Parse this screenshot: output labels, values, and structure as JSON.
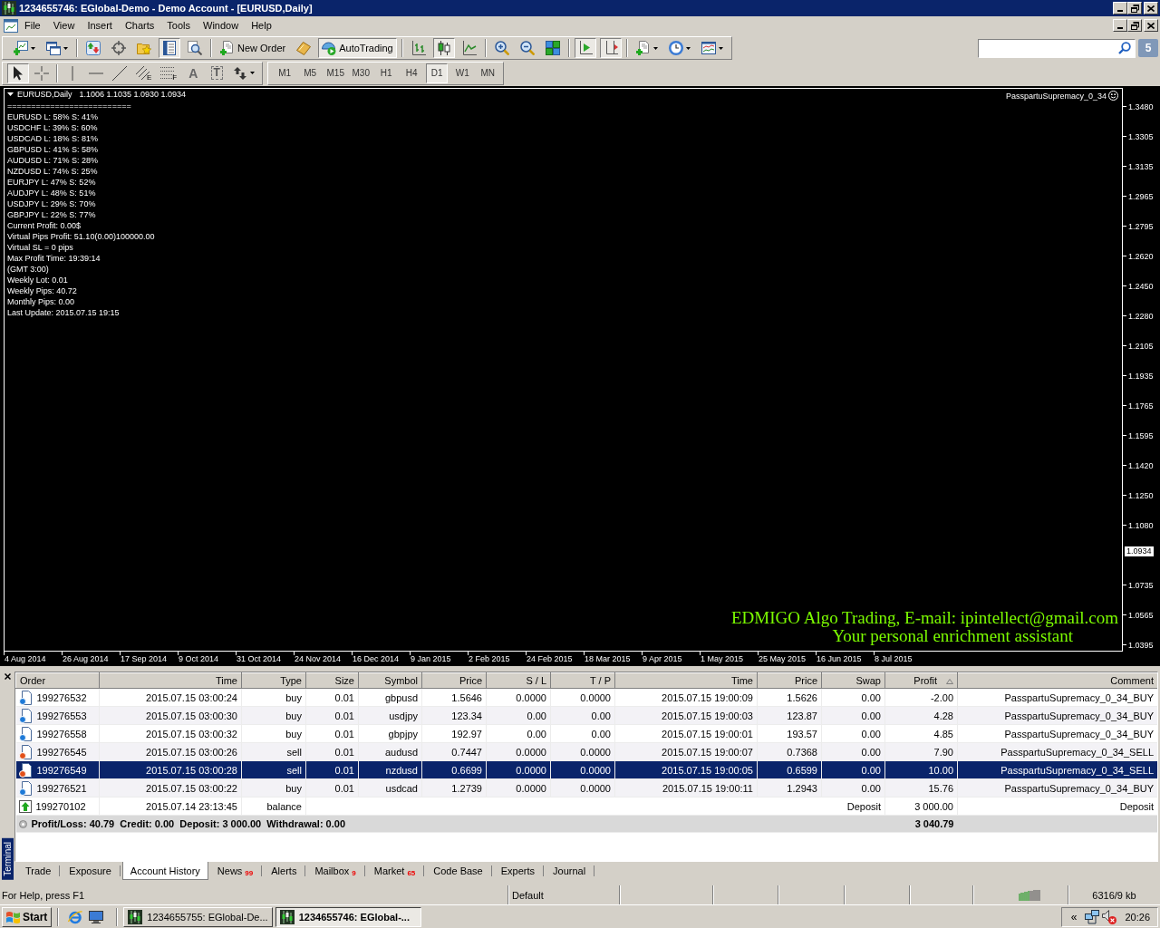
{
  "window": {
    "title": "1234655746: EGlobal-Demo - Demo Account - [EURUSD,Daily]"
  },
  "menu": [
    "File",
    "View",
    "Insert",
    "Charts",
    "Tools",
    "Window",
    "Help"
  ],
  "toolbar": {
    "groups": [
      [
        {
          "pressed": false,
          "dropdown": true
        },
        {
          "pressed": false,
          "dropdown": true
        }
      ],
      [
        {
          "pressed": false,
          "dropdown": false
        },
        {
          "pressed": false,
          "dropdown": false
        },
        {
          "pressed": false,
          "dropdown": false
        },
        {
          "pressed": true,
          "dropdown": false
        },
        {
          "pressed": false,
          "dropdown": false
        }
      ],
      [
        {
          "label": "New Order",
          "pressed": false,
          "dropdown": false
        },
        {
          "pressed": false,
          "dropdown": false
        },
        {
          "label": "AutoTrading",
          "pressed": true,
          "dropdown": false
        }
      ],
      [
        {
          "pressed": false,
          "dropdown": false
        },
        {
          "pressed": true,
          "dropdown": false
        },
        {
          "pressed": false,
          "dropdown": false
        }
      ],
      [
        {
          "pressed": false,
          "dropdown": false
        },
        {
          "pressed": false,
          "dropdown": false
        },
        {
          "pressed": false,
          "dropdown": false
        }
      ],
      [
        {
          "pressed": true,
          "dropdown": false
        },
        {
          "pressed": true,
          "dropdown": false
        }
      ],
      [
        {
          "pressed": false,
          "dropdown": true
        },
        {
          "pressed": false,
          "dropdown": true
        },
        {
          "pressed": false,
          "dropdown": true
        }
      ]
    ],
    "badge": "5"
  },
  "drawing_tools": {
    "groups": [
      [
        {
          "pressed": true,
          "dropdown": false
        },
        {
          "pressed": false,
          "dropdown": false
        }
      ],
      [
        {
          "pressed": false,
          "dropdown": false
        },
        {
          "pressed": false,
          "dropdown": false
        },
        {
          "pressed": false,
          "dropdown": false
        },
        {
          "label": "E",
          "pressed": false,
          "dropdown": false
        },
        {
          "label": "F",
          "pressed": false,
          "dropdown": false
        },
        {
          "label": "A",
          "pressed": false,
          "dropdown": false
        },
        {
          "label": "T",
          "pressed": false,
          "dropdown": false
        },
        {
          "pressed": false,
          "dropdown": true
        }
      ]
    ]
  },
  "timeframes": [
    {
      "label": "M1",
      "selected": false
    },
    {
      "label": "M5",
      "selected": false
    },
    {
      "label": "M15",
      "selected": false
    },
    {
      "label": "M30",
      "selected": false
    },
    {
      "label": "H1",
      "selected": false
    },
    {
      "label": "H4",
      "selected": false
    },
    {
      "label": "D1",
      "selected": true
    },
    {
      "label": "W1",
      "selected": false
    },
    {
      "label": "MN",
      "selected": false
    }
  ],
  "chart": {
    "header": {
      "symbol": "EURUSD,Daily",
      "prices": "1.1006 1.1035 1.0930 1.0934"
    },
    "comment": [
      "==========================",
      "EURUSD L: 58% S: 41%",
      "USDCHF L: 39% S: 60%",
      "USDCAD L: 18% S: 81%",
      "GBPUSD L: 41% S: 58%",
      "AUDUSD L: 71% S: 28%",
      "NZDUSD L: 74% S: 25%",
      "EURJPY L: 47% S: 52%",
      "AUDJPY L: 48% S: 51%",
      "USDJPY L: 29% S: 70%",
      "GBPJPY L: 22% S: 77%",
      "Current Profit: 0.00$",
      "Virtual Pips Profit: 51.10(0.00)100000.00",
      "Virtual SL = 0 pips",
      "Max Profit Time: 19:39:14",
      "(GMT 3:00)",
      "Weekly Lot: 0.01",
      "Weekly Pips: 40.72",
      "Monthly Pips: 0.00",
      "Last Update: 2015.07.15 19:15"
    ],
    "expert": "PasspartuSupremacy_0_34",
    "banner": [
      "EDMIGO Algo Trading, E-mail: ipintellect@gmail.com",
      "Your personal enrichment assistant"
    ],
    "price_axis": [
      {
        "text": "1.3480",
        "kind": "tick"
      },
      {
        "text": "1.3305",
        "kind": "tick"
      },
      {
        "text": "1.3135",
        "kind": "tick"
      },
      {
        "text": "1.2965",
        "kind": "tick"
      },
      {
        "text": "1.2795",
        "kind": "tick"
      },
      {
        "text": "1.2620",
        "kind": "tick"
      },
      {
        "text": "1.2450",
        "kind": "tick"
      },
      {
        "text": "1.2280",
        "kind": "tick"
      },
      {
        "text": "1.2105",
        "kind": "tick"
      },
      {
        "text": "1.1935",
        "kind": "tick"
      },
      {
        "text": "1.1765",
        "kind": "tick"
      },
      {
        "text": "1.1595",
        "kind": "tick"
      },
      {
        "text": "1.1420",
        "kind": "tick"
      },
      {
        "text": "1.1250",
        "kind": "tick"
      },
      {
        "text": "1.1080",
        "kind": "tick"
      },
      {
        "text": "1.0934",
        "kind": "current"
      },
      {
        "text": "1.0735",
        "kind": "tick"
      },
      {
        "text": "1.0565",
        "kind": "tick"
      },
      {
        "text": "1.0395",
        "kind": "tick"
      }
    ],
    "time_axis": [
      "4 Aug 2014",
      "26 Aug 2014",
      "17 Sep 2014",
      "9 Oct 2014",
      "31 Oct 2014",
      "24 Nov 2014",
      "16 Dec 2014",
      "9 Jan 2015",
      "2 Feb 2015",
      "24 Feb 2015",
      "18 Mar 2015",
      "9 Apr 2015",
      "1 May 2015",
      "25 May 2015",
      "16 Jun 2015",
      "8 Jul 2015"
    ]
  },
  "terminal": {
    "label": "Terminal",
    "columns": [
      {
        "label": "Order",
        "sorted": false
      },
      {
        "label": "Time",
        "sorted": false
      },
      {
        "label": "Type",
        "sorted": false
      },
      {
        "label": "Size",
        "sorted": false
      },
      {
        "label": "Symbol",
        "sorted": false
      },
      {
        "label": "Price",
        "sorted": false
      },
      {
        "label": "S / L",
        "sorted": false
      },
      {
        "label": "T / P",
        "sorted": false
      },
      {
        "label": "Time",
        "sorted": false
      },
      {
        "label": "Price",
        "sorted": false
      },
      {
        "label": "Swap",
        "sorted": false
      },
      {
        "label": "Profit",
        "sorted": true
      },
      {
        "label": "Comment",
        "sorted": false
      }
    ],
    "rows": [
      {
        "kind": "buy",
        "selected": false,
        "order": "199276532",
        "open_time": "2015.07.15 03:00:24",
        "type": "buy",
        "size": "0.01",
        "symbol": "gbpusd",
        "open_price": "1.5646",
        "sl": "0.0000",
        "tp": "0.0000",
        "close_time": "2015.07.15 19:00:09",
        "close_price": "1.5626",
        "swap": "0.00",
        "profit": "-2.00",
        "comment": "PasspartuSupremacy_0_34_BUY"
      },
      {
        "kind": "buy",
        "selected": false,
        "order": "199276553",
        "open_time": "2015.07.15 03:00:30",
        "type": "buy",
        "size": "0.01",
        "symbol": "usdjpy",
        "open_price": "123.34",
        "sl": "0.00",
        "tp": "0.00",
        "close_time": "2015.07.15 19:00:03",
        "close_price": "123.87",
        "swap": "0.00",
        "profit": "4.28",
        "comment": "PasspartuSupremacy_0_34_BUY"
      },
      {
        "kind": "buy",
        "selected": false,
        "order": "199276558",
        "open_time": "2015.07.15 03:00:32",
        "type": "buy",
        "size": "0.01",
        "symbol": "gbpjpy",
        "open_price": "192.97",
        "sl": "0.00",
        "tp": "0.00",
        "close_time": "2015.07.15 19:00:01",
        "close_price": "193.57",
        "swap": "0.00",
        "profit": "4.85",
        "comment": "PasspartuSupremacy_0_34_BUY"
      },
      {
        "kind": "sell",
        "selected": false,
        "order": "199276545",
        "open_time": "2015.07.15 03:00:26",
        "type": "sell",
        "size": "0.01",
        "symbol": "audusd",
        "open_price": "0.7447",
        "sl": "0.0000",
        "tp": "0.0000",
        "close_time": "2015.07.15 19:00:07",
        "close_price": "0.7368",
        "swap": "0.00",
        "profit": "7.90",
        "comment": "PasspartuSupremacy_0_34_SELL"
      },
      {
        "kind": "sell",
        "selected": true,
        "order": "199276549",
        "open_time": "2015.07.15 03:00:28",
        "type": "sell",
        "size": "0.01",
        "symbol": "nzdusd",
        "open_price": "0.6699",
        "sl": "0.0000",
        "tp": "0.0000",
        "close_time": "2015.07.15 19:00:05",
        "close_price": "0.6599",
        "swap": "0.00",
        "profit": "10.00",
        "comment": "PasspartuSupremacy_0_34_SELL"
      },
      {
        "kind": "buy",
        "selected": false,
        "order": "199276521",
        "open_time": "2015.07.15 03:00:22",
        "type": "buy",
        "size": "0.01",
        "symbol": "usdcad",
        "open_price": "1.2739",
        "sl": "0.0000",
        "tp": "0.0000",
        "close_time": "2015.07.15 19:00:11",
        "close_price": "1.2943",
        "swap": "0.00",
        "profit": "15.76",
        "comment": "PasspartuSupremacy_0_34_BUY"
      },
      {
        "kind": "balance",
        "selected": false,
        "order": "199270102",
        "open_time": "2015.07.14 23:13:45",
        "type": "balance",
        "note": "Deposit",
        "profit": "3 000.00",
        "comment": "Deposit"
      }
    ],
    "summary": {
      "text": "Profit/Loss: 40.79  Credit: 0.00  Deposit: 3 000.00  Withdrawal: 0.00",
      "total": "3 040.79"
    },
    "tabs": [
      {
        "label": "Trade",
        "selected": false
      },
      {
        "label": "Exposure",
        "selected": false
      },
      {
        "label": "Account History",
        "selected": true
      },
      {
        "label": "News",
        "count": "99",
        "selected": false
      },
      {
        "label": "Alerts",
        "selected": false
      },
      {
        "label": "Mailbox",
        "count": "9",
        "selected": false
      },
      {
        "label": "Market",
        "count": "65",
        "selected": false
      },
      {
        "label": "Code Base",
        "selected": false
      },
      {
        "label": "Experts",
        "selected": false
      },
      {
        "label": "Journal",
        "selected": false
      }
    ]
  },
  "status_bar": {
    "help": "For Help, press F1",
    "profile": "Default",
    "traffic": "6316/9 kb"
  },
  "taskbar": {
    "start": "Start",
    "tasks": [
      {
        "label": "1234655755: EGlobal-De...",
        "selected": false
      },
      {
        "label": "1234655746: EGlobal-...",
        "selected": true
      }
    ],
    "tray_toggle": "«",
    "clock": "20:26"
  }
}
